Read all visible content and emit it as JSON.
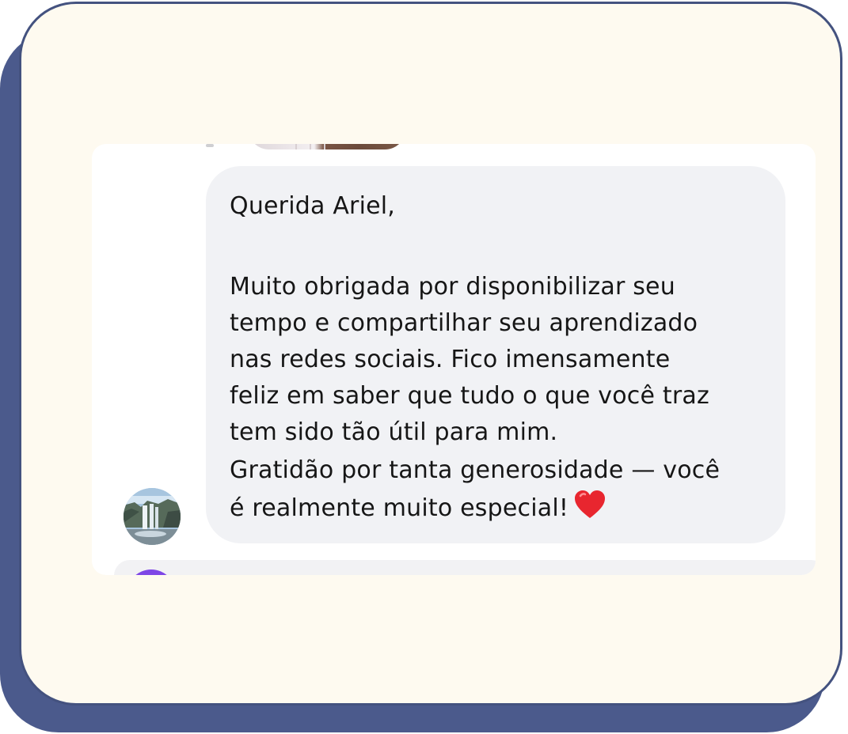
{
  "message": {
    "lines": [
      "Querida Ariel,",
      "Muito obrigada por disponibilizar seu",
      "tempo e compartilhar seu aprendizado",
      "nas redes sociais. Fico imensamente",
      "feliz em saber que tudo o que você traz",
      "tem sido tão útil para mim.",
      "Gratidão por tanta generosidade — você",
      "é realmente muito especial!"
    ],
    "trailing_icon": "heart-icon"
  },
  "colors": {
    "card_background": "#fefaf0",
    "card_border": "#44527f",
    "card_shadow": "#4b5a8c",
    "chat_background": "#ffffff",
    "bubble_background": "#f1f2f5",
    "text": "#161616",
    "heart": "#e8262f",
    "next_avatar": "#7e46e6"
  }
}
